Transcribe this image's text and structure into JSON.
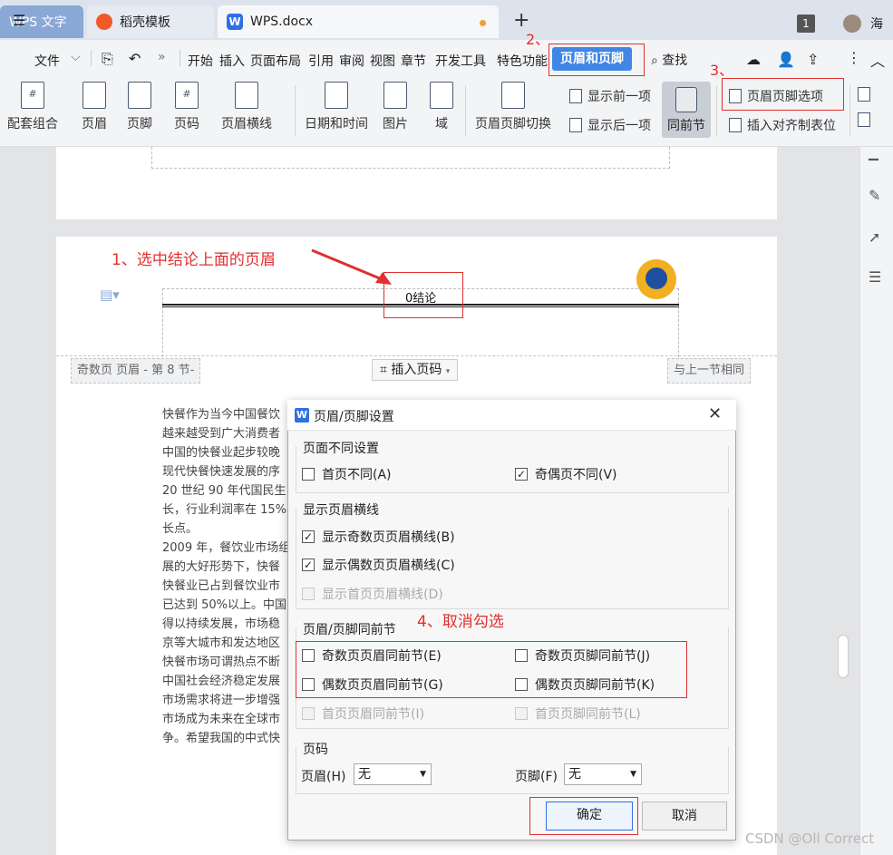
{
  "tabs": {
    "wps": "WPS 文字",
    "daoke": "稻壳模板",
    "doc": "WPS.docx",
    "doc_icon": "W",
    "new_tab": "+",
    "count": "1",
    "user": "海"
  },
  "menu": {
    "file": "文件",
    "items": [
      "开始",
      "插入",
      "页面布局",
      "引用",
      "审阅",
      "视图",
      "章节",
      "开发工具",
      "特色功能"
    ],
    "header_footer": "页眉和页脚",
    "search": "查找"
  },
  "ribbon": {
    "buttons": [
      "配套组合",
      "页眉",
      "页脚",
      "页码",
      "页眉横线",
      "日期和时间",
      "图片",
      "域",
      "页眉页脚切换"
    ],
    "show_prev": "显示前一项",
    "show_next": "显示后一项",
    "same_section": "同前节",
    "hf_options": "页眉页脚选项",
    "insert_align_tab": "插入对齐制表位"
  },
  "annotations": {
    "step1": "1、选中结论上面的页眉",
    "step2": "2、",
    "step3": "3、",
    "step4": "4、取消勾选"
  },
  "document": {
    "header_text": "0结论",
    "odd_header_tag": "奇数页 页眉  - 第 8 节-",
    "insert_page_number": "插入页码",
    "same_as_previous": "与上一节相同",
    "body_lines": [
      "快餐作为当今中国餐饮",
      "越来越受到广大消费者",
      "中国的快餐业起步较晚",
      "现代快餐快速发展的序",
      "20 世纪 90 年代国民生",
      "长，行业利润率在 15%",
      "长点。",
      "2009 年，餐饮业市场组",
      "展的大好形势下，快餐",
      "快餐业已占到餐饮业市",
      "已达到 50%以上。中国",
      "得以持续发展，市场稳",
      "京等大城市和发达地区",
      "快餐市场可谓热点不断",
      "中国社会经济稳定发展",
      "市场需求将进一步增强",
      "市场成为未来在全球市",
      "争。希望我国的中式快"
    ]
  },
  "dialog": {
    "title": "页眉/页脚设置",
    "group1": "页面不同设置",
    "first_page_diff": "首页不同(A)",
    "odd_even_diff": "奇偶页不同(V)",
    "group2": "显示页眉横线",
    "show_odd_line": "显示奇数页页眉横线(B)",
    "show_even_line": "显示偶数页页眉横线(C)",
    "show_first_line": "显示首页页眉横线(D)",
    "group3": "页眉/页脚同前节",
    "odd_header_same": "奇数页页眉同前节(E)",
    "odd_footer_same": "奇数页页脚同前节(J)",
    "even_header_same": "偶数页页眉同前节(G)",
    "even_footer_same": "偶数页页脚同前节(K)",
    "first_header_same": "首页页眉同前节(I)",
    "first_footer_same": "首页页脚同前节(L)",
    "group4": "页码",
    "header_label": "页眉(H)",
    "header_value": "无",
    "footer_label": "页脚(F)",
    "footer_value": "无",
    "ok": "确定",
    "cancel": "取消"
  },
  "watermark": "CSDN @Oll Correct"
}
